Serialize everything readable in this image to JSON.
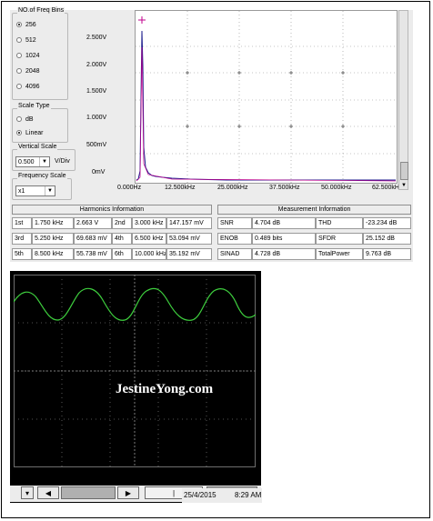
{
  "freq_bins": {
    "title": "NO.of Freq Bins",
    "options": [
      "256",
      "512",
      "1024",
      "2048",
      "4096"
    ],
    "selected": "256"
  },
  "scale_type": {
    "title": "Scale Type",
    "options": [
      "dB",
      "Linear"
    ],
    "selected": "Linear"
  },
  "vertical_scale": {
    "title": "Vertical Scale",
    "value": "0.500",
    "unit": "V/Div"
  },
  "frequency_scale": {
    "title": "Frequency Scale",
    "value": "x1"
  },
  "spectrum": {
    "y_ticks": [
      "2.500V",
      "2.000V",
      "1.500V",
      "1.000V",
      "500mV",
      "0mV"
    ],
    "x_ticks": [
      "0.000Hz",
      "12.500kHz",
      "25.000kHz",
      "37.500kHz",
      "50.000kHz",
      "62.500kHz"
    ],
    "trace_color": "#1a1a8c",
    "marker_color": "#c0008c"
  },
  "harmonics": {
    "title": "Harmonics Information",
    "rows": [
      [
        {
          "n": "1st",
          "f": "1.750 kHz",
          "v": "2.663 V"
        },
        {
          "n": "2nd",
          "f": "3.000 kHz",
          "v": "147.157 mV"
        }
      ],
      [
        {
          "n": "3rd",
          "f": "5.250 kHz",
          "v": "69.683 mV"
        },
        {
          "n": "4th",
          "f": "6.500 kHz",
          "v": "53.094 mV"
        }
      ],
      [
        {
          "n": "5th",
          "f": "8.500 kHz",
          "v": "55.738 mV"
        },
        {
          "n": "6th",
          "f": "10.000 kHz",
          "v": "35.192 mV"
        }
      ]
    ]
  },
  "measurement": {
    "title": "Measurement Information",
    "rows": [
      [
        {
          "k": "SNR",
          "v": "4.704 dB"
        },
        {
          "k": "THD",
          "v": "-23.234 dB"
        }
      ],
      [
        {
          "k": "ENOB",
          "v": "0.489 bits"
        },
        {
          "k": "SFDR",
          "v": "25.152 dB"
        }
      ],
      [
        {
          "k": "SINAD",
          "v": "4.728 dB"
        },
        {
          "k": "TotalPower",
          "v": "9.763 dB"
        }
      ]
    ]
  },
  "scope": {
    "watermark": "JestineYong.com",
    "trace_color": "#3ecf3e",
    "date": "25/4/2015",
    "time": "8:29 AM"
  }
}
